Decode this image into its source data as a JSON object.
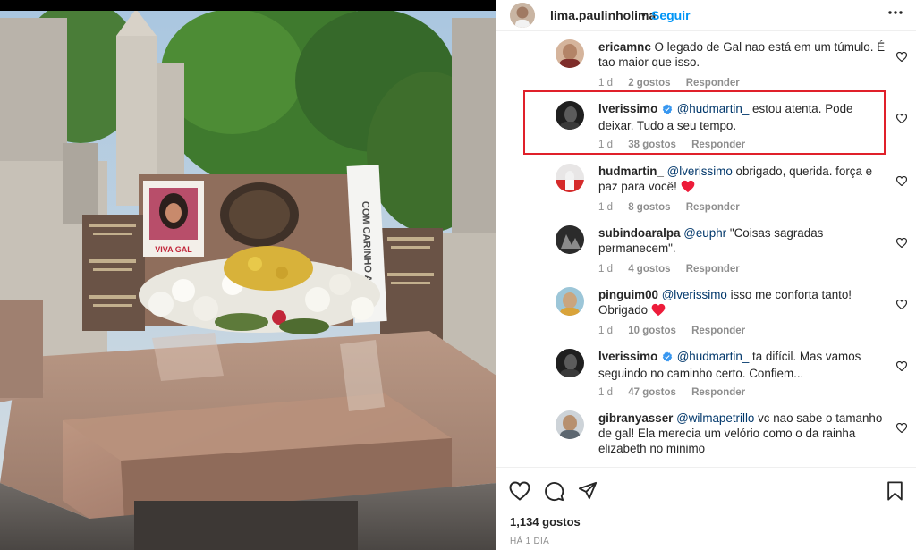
{
  "post": {
    "username": "lima.paulinholima",
    "separator": "•",
    "follow_label": "Seguir",
    "more_label": "•••",
    "likes_total": "1,134 gostos",
    "timestamp": "HÁ 1 DIA"
  },
  "photo": {
    "sign_text": "COM CARINHO A...",
    "poster_text": "VIVA GAL"
  },
  "comments": [
    {
      "user": "ericamnc",
      "mention": "",
      "text": "O legado de Gal nao está em um túmulo. É tao maior que isso.",
      "age": "1 d",
      "likes": "2 gostos",
      "reply": "Responder",
      "verified": false
    },
    {
      "user": "lverissimo",
      "mention": "@hudmartin_",
      "text": "estou atenta. Pode deixar. Tudo a seu tempo.",
      "age": "1 d",
      "likes": "38 gostos",
      "reply": "Responder",
      "verified": true
    },
    {
      "user": "hudmartin_",
      "mention": "@lverissimo",
      "text": "obrigado, querida. força e paz para você!",
      "age": "1 d",
      "likes": "8 gostos",
      "reply": "Responder",
      "verified": false
    },
    {
      "user": "subindoaralpa",
      "mention": "@euphr",
      "text": "\"Coisas sagradas permanecem\".",
      "age": "1 d",
      "likes": "4 gostos",
      "reply": "Responder",
      "verified": false
    },
    {
      "user": "pinguim00",
      "mention": "@lverissimo",
      "text": "isso me conforta tanto! Obrigado",
      "age": "1 d",
      "likes": "10 gostos",
      "reply": "Responder",
      "verified": false
    },
    {
      "user": "lverissimo",
      "mention": "@hudmartin_",
      "text": "ta difícil. Mas vamos seguindo no caminho certo. Confiem...",
      "age": "1 d",
      "likes": "47 gostos",
      "reply": "Responder",
      "verified": true
    },
    {
      "user": "gibranyasser",
      "mention": "@wilmapetrillo",
      "text": "vc nao sabe o tamanho de gal! Ela merecia um velório como o da rainha elizabeth no minimo",
      "age": "",
      "likes": "",
      "reply": "",
      "verified": false
    }
  ],
  "colors": {
    "link": "#0095f6",
    "mention": "#00376b",
    "highlight": "#e0202a",
    "muted": "#8e8e8e",
    "heart": "#ed1c3a"
  },
  "icons": [
    "more-options-icon",
    "verified-badge-icon",
    "heart-outline-icon",
    "comment-icon",
    "share-icon",
    "bookmark-icon",
    "red-heart-emoji"
  ]
}
